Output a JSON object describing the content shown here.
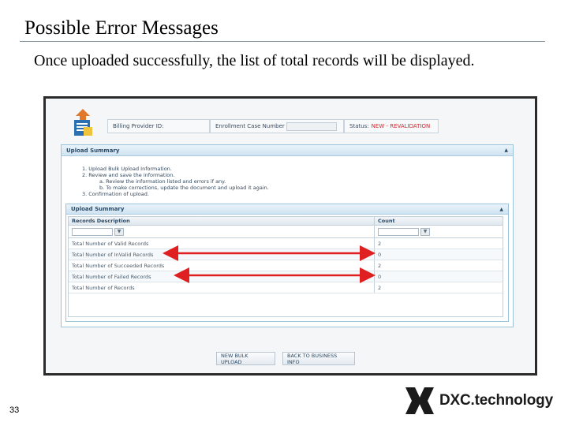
{
  "slide": {
    "title": "Possible Error Messages",
    "subtitle": "Once uploaded successfully, the list of total records will be displayed.",
    "page_number": "33",
    "logo_text": "DXC.technology"
  },
  "header": {
    "billing_provider_label": "Billing Provider ID:",
    "enrollment_case_label": "Enrollment Case Number",
    "status_label": "Status:",
    "status_value": "NEW - REVALIDATION"
  },
  "upload_summary_panel": {
    "title": "Upload Summary",
    "steps": [
      "1.  Upload Bulk Upload Information.",
      "2.  Review and save the information.",
      "a.  Review the information listed and errors if any.",
      "b.  To make corrections, update the document and upload it again.",
      "3.  Confirmation of upload."
    ]
  },
  "inner_panel": {
    "title": "Upload Summary",
    "columns": [
      "Records Description",
      "Count"
    ],
    "rows": [
      {
        "description": "Total Number of Valid Records",
        "count": "2"
      },
      {
        "description": "Total Number of InValid Records",
        "count": "0"
      },
      {
        "description": "Total Number of Succeeded Records",
        "count": "2"
      },
      {
        "description": "Total Number of Failed Records",
        "count": "0"
      },
      {
        "description": "Total Number of Records",
        "count": "2"
      }
    ]
  },
  "buttons": {
    "new_bulk_upload": "NEW BULK UPLOAD",
    "back_to_business_info": "BACK TO BUSINESS INFO"
  },
  "colors": {
    "status_red": "#d6262a",
    "arrow_red": "#e02020",
    "panel_border": "#9cc3dc"
  },
  "icons": [
    "upload-document-icon",
    "collapse-caret-icon",
    "filter-icon",
    "dxc-logo-icon"
  ]
}
